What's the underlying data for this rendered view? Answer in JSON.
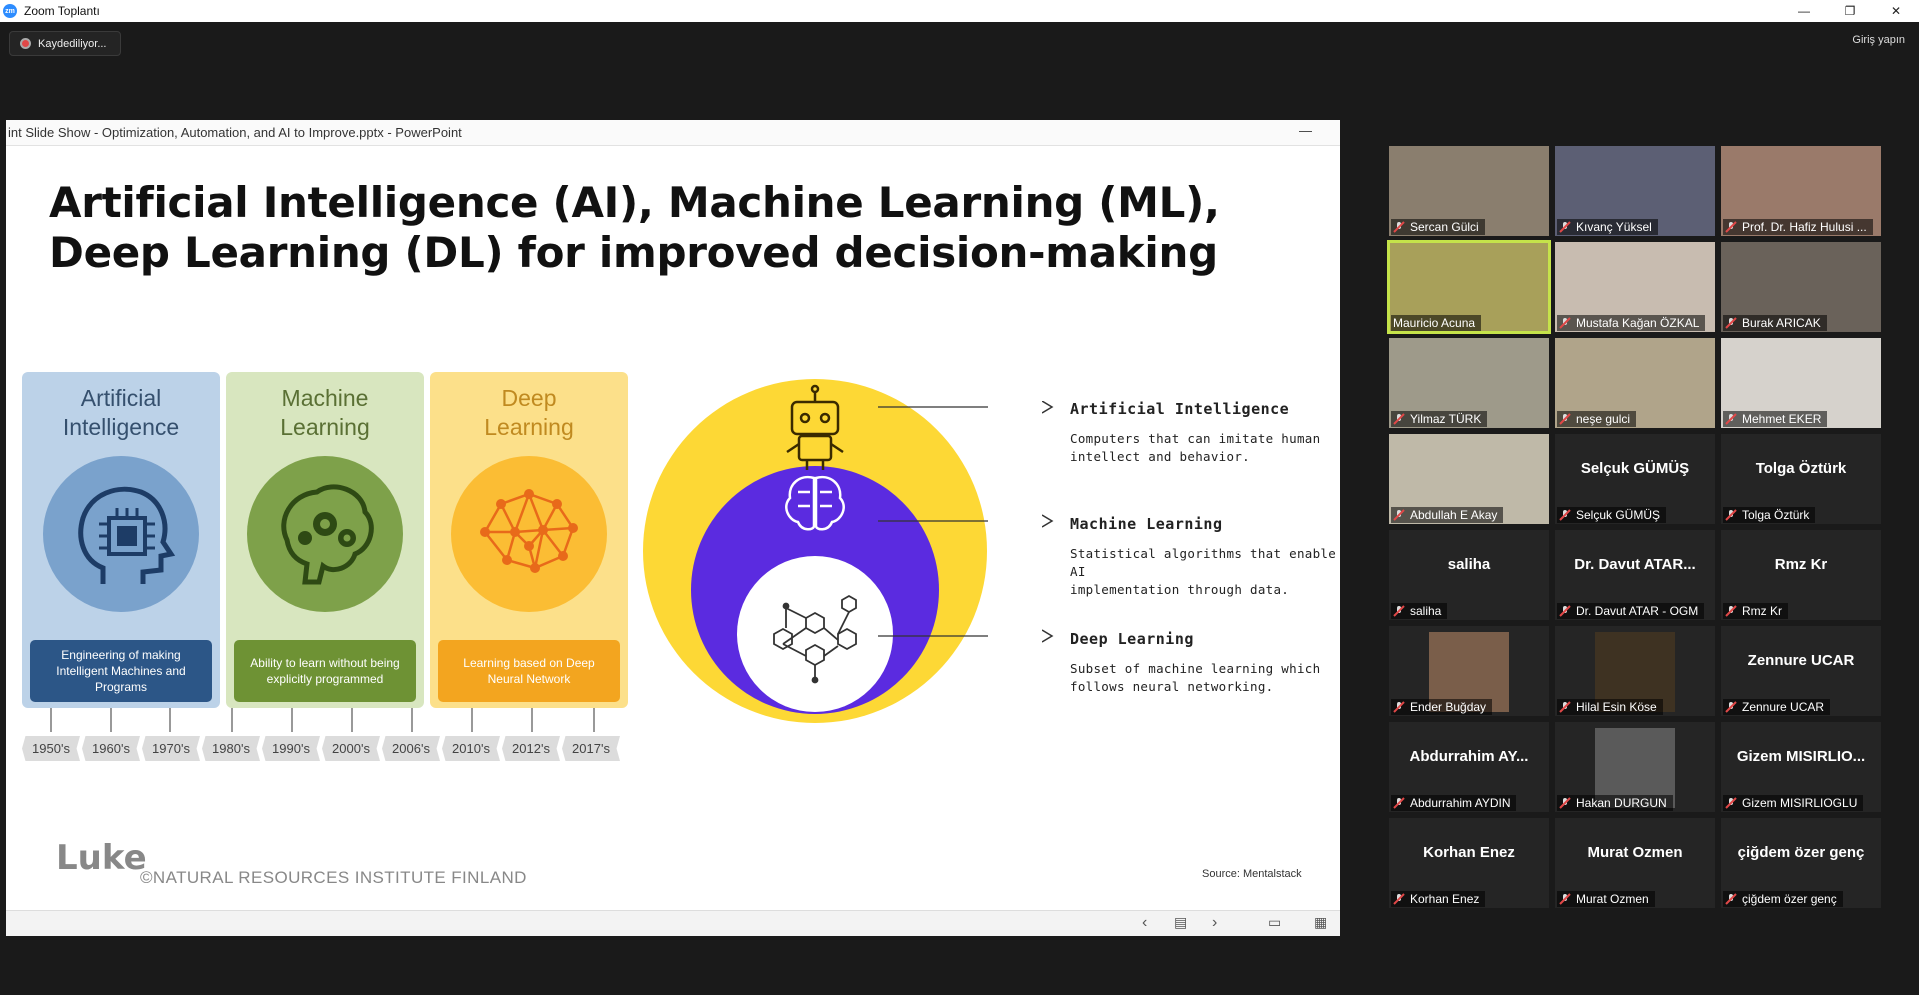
{
  "window": {
    "title": "Zoom Toplantı",
    "minimize": "—",
    "restore": "❐",
    "close": "✕"
  },
  "recording": {
    "label": "Kaydediliyor..."
  },
  "signin": {
    "label": "Giriş yapın"
  },
  "ppt": {
    "window_title": "int Slide Show  -  Optimization, Automation, and AI to Improve.pptx - PowerPoint",
    "minimize": "—",
    "slide_title_line1": "Artificial Intelligence (AI), Machine Learning (ML),",
    "slide_title_line2": "Deep Learning (DL) for improved decision-making",
    "panels": [
      {
        "heading_1": "Artificial",
        "heading_2": "Intelligence",
        "desc": "Engineering of making Intelligent Machines and Programs",
        "icon": "head-chip-icon"
      },
      {
        "heading_1": "Machine",
        "heading_2": "Learning",
        "desc": "Ability to learn without being explicitly programmed",
        "icon": "brain-gears-icon"
      },
      {
        "heading_1": "Deep",
        "heading_2": "Learning",
        "desc": "Learning based on Deep Neural Network",
        "icon": "neural-brain-icon"
      }
    ],
    "decades": [
      "1950's",
      "1960's",
      "1970's",
      "1980's",
      "1990's",
      "2000's",
      "2006's",
      "2010's",
      "2012's",
      "2017's"
    ],
    "annotations": [
      {
        "title": "Artificial Intelligence",
        "text_1": "Computers that can imitate human",
        "text_2": "intellect and behavior."
      },
      {
        "title": "Machine Learning",
        "text_1": "Statistical algorithms that enable AI",
        "text_2": "implementation through data."
      },
      {
        "title": "Deep Learning",
        "text_1": "Subset of machine learning which",
        "text_2": "follows neural networking."
      }
    ],
    "logo_text": "Luke",
    "copyright": "©NATURAL RESOURCES INSTITUTE FINLAND",
    "source": "Source: Mentalstack",
    "nav": {
      "prev": "‹",
      "next": "›"
    }
  },
  "colors": {
    "venn_outer": "#fdd835",
    "venn_middle": "#5b2be0",
    "venn_inner": "#ffffff",
    "active_speaker": "#c5e34a",
    "mic_muted": "#e04848"
  },
  "participants": [
    {
      "name": "Sercan Gülci",
      "video": true
    },
    {
      "name": "Kıvanç Yüksel",
      "video": true
    },
    {
      "name": "Prof. Dr. Hafiz Hulusi ...",
      "video": true
    },
    {
      "name": "Mauricio Acuna",
      "video": true,
      "active": true
    },
    {
      "name": "Mustafa Kağan ÖZKAL",
      "video": true
    },
    {
      "name": "Burak ARICAK",
      "video": true
    },
    {
      "name": "Yilmaz TÜRK",
      "video": true
    },
    {
      "name": "neşe gulci",
      "video": true
    },
    {
      "name": "Mehmet EKER",
      "video": true
    },
    {
      "name": "Abdullah E Akay",
      "video": true
    },
    {
      "name": "Selçuk GÜMÜŞ",
      "display": "Selçuk GÜMÜŞ"
    },
    {
      "name": "Tolga Öztürk",
      "display": "Tolga Öztürk"
    },
    {
      "name": "saliha",
      "display": "saliha"
    },
    {
      "name": "Dr. Davut ATAR - OGM",
      "display": "Dr. Davut ATAR..."
    },
    {
      "name": "Rmz Kr",
      "display": "Rmz Kr"
    },
    {
      "name": "Ender Buğday",
      "photo": true
    },
    {
      "name": "Hilal Esin Köse",
      "photo": true
    },
    {
      "name": "Zennure UCAR",
      "display": "Zennure UCAR"
    },
    {
      "name": "Abdurrahim AYDIN",
      "display": "Abdurrahim  AY..."
    },
    {
      "name": "Hakan DURGUN",
      "photo": true
    },
    {
      "name": "Gizem MISIRLIOGLU",
      "display": "Gizem  MISIRLIO..."
    },
    {
      "name": "Korhan Enez",
      "display": "Korhan Enez"
    },
    {
      "name": "Murat Ozmen",
      "display": "Murat Ozmen"
    },
    {
      "name": "çiğdem özer genç",
      "display": "çiğdem özer genç"
    }
  ]
}
